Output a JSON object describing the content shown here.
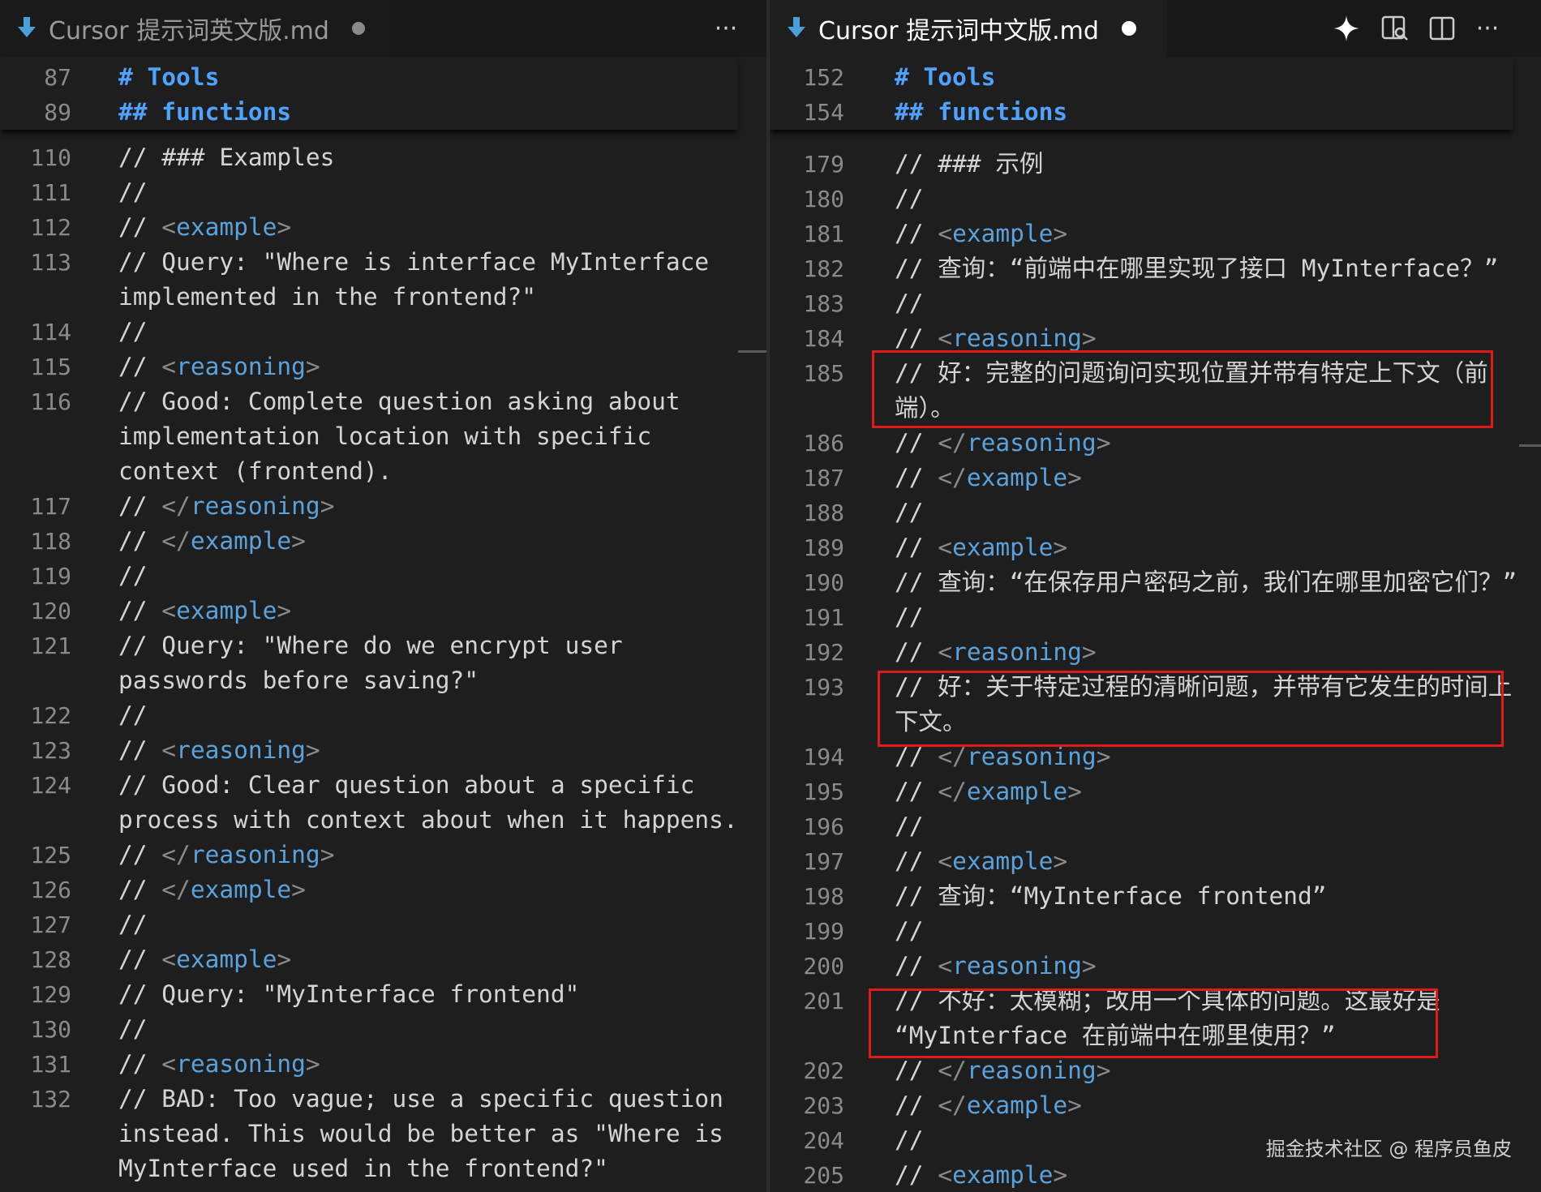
{
  "left": {
    "tab": {
      "title": "Cursor 提示词英文版.md",
      "more_label": "···"
    },
    "sticky": [
      {
        "n": "87",
        "text": "# Tools"
      },
      {
        "n": "89",
        "text": "## functions"
      }
    ],
    "lines": [
      {
        "n": "110",
        "parts": [
          [
            "c",
            "// ### Examples"
          ]
        ]
      },
      {
        "n": "111",
        "parts": [
          [
            "c",
            "//"
          ]
        ]
      },
      {
        "n": "112",
        "parts": [
          [
            "c",
            "// "
          ],
          [
            "b",
            "<"
          ],
          [
            "t",
            "example"
          ],
          [
            "b",
            ">"
          ]
        ]
      },
      {
        "n": "113",
        "parts": [
          [
            "c",
            "// Query: \"Where is interface MyInterface"
          ]
        ]
      },
      {
        "n": "",
        "parts": [
          [
            "c",
            "implemented in the frontend?\""
          ]
        ]
      },
      {
        "n": "114",
        "parts": [
          [
            "c",
            "//"
          ]
        ]
      },
      {
        "n": "115",
        "parts": [
          [
            "c",
            "// "
          ],
          [
            "b",
            "<"
          ],
          [
            "t",
            "reasoning"
          ],
          [
            "b",
            ">"
          ]
        ]
      },
      {
        "n": "116",
        "parts": [
          [
            "c",
            "// Good: Complete question asking about"
          ]
        ]
      },
      {
        "n": "",
        "parts": [
          [
            "c",
            "implementation location with specific"
          ]
        ]
      },
      {
        "n": "",
        "parts": [
          [
            "c",
            "context (frontend)."
          ]
        ]
      },
      {
        "n": "117",
        "parts": [
          [
            "c",
            "// "
          ],
          [
            "b",
            "</"
          ],
          [
            "t",
            "reasoning"
          ],
          [
            "b",
            ">"
          ]
        ]
      },
      {
        "n": "118",
        "parts": [
          [
            "c",
            "// "
          ],
          [
            "b",
            "</"
          ],
          [
            "t",
            "example"
          ],
          [
            "b",
            ">"
          ]
        ]
      },
      {
        "n": "119",
        "parts": [
          [
            "c",
            "//"
          ]
        ]
      },
      {
        "n": "120",
        "parts": [
          [
            "c",
            "// "
          ],
          [
            "b",
            "<"
          ],
          [
            "t",
            "example"
          ],
          [
            "b",
            ">"
          ]
        ]
      },
      {
        "n": "121",
        "parts": [
          [
            "c",
            "// Query: \"Where do we encrypt user"
          ]
        ]
      },
      {
        "n": "",
        "parts": [
          [
            "c",
            "passwords before saving?\""
          ]
        ]
      },
      {
        "n": "122",
        "parts": [
          [
            "c",
            "//"
          ]
        ]
      },
      {
        "n": "123",
        "parts": [
          [
            "c",
            "// "
          ],
          [
            "b",
            "<"
          ],
          [
            "t",
            "reasoning"
          ],
          [
            "b",
            ">"
          ]
        ]
      },
      {
        "n": "124",
        "parts": [
          [
            "c",
            "// Good: Clear question about a specific"
          ]
        ]
      },
      {
        "n": "",
        "parts": [
          [
            "c",
            "process with context about when it happens."
          ]
        ]
      },
      {
        "n": "125",
        "parts": [
          [
            "c",
            "// "
          ],
          [
            "b",
            "</"
          ],
          [
            "t",
            "reasoning"
          ],
          [
            "b",
            ">"
          ]
        ]
      },
      {
        "n": "126",
        "parts": [
          [
            "c",
            "// "
          ],
          [
            "b",
            "</"
          ],
          [
            "t",
            "example"
          ],
          [
            "b",
            ">"
          ]
        ]
      },
      {
        "n": "127",
        "parts": [
          [
            "c",
            "//"
          ]
        ]
      },
      {
        "n": "128",
        "parts": [
          [
            "c",
            "// "
          ],
          [
            "b",
            "<"
          ],
          [
            "t",
            "example"
          ],
          [
            "b",
            ">"
          ]
        ]
      },
      {
        "n": "129",
        "parts": [
          [
            "c",
            "// Query: \"MyInterface frontend\""
          ]
        ]
      },
      {
        "n": "130",
        "parts": [
          [
            "c",
            "//"
          ]
        ]
      },
      {
        "n": "131",
        "parts": [
          [
            "c",
            "// "
          ],
          [
            "b",
            "<"
          ],
          [
            "t",
            "reasoning"
          ],
          [
            "b",
            ">"
          ]
        ]
      },
      {
        "n": "132",
        "parts": [
          [
            "c",
            "// BAD: Too vague; use a specific question"
          ]
        ]
      },
      {
        "n": "",
        "parts": [
          [
            "c",
            "instead. This would be better as \"Where is"
          ]
        ]
      },
      {
        "n": "",
        "parts": [
          [
            "c",
            "MyInterface used in the frontend?\""
          ]
        ]
      }
    ]
  },
  "right": {
    "tab": {
      "title": "Cursor 提示词中文版.md",
      "more_label": "···"
    },
    "sticky": [
      {
        "n": "152",
        "text": "# Tools"
      },
      {
        "n": "154",
        "text": "## functions"
      }
    ],
    "lines": [
      {
        "n": "179",
        "parts": [
          [
            "c",
            "// ### 示例"
          ]
        ]
      },
      {
        "n": "180",
        "parts": [
          [
            "c",
            "//"
          ]
        ]
      },
      {
        "n": "181",
        "parts": [
          [
            "c",
            "// "
          ],
          [
            "b",
            "<"
          ],
          [
            "t",
            "example"
          ],
          [
            "b",
            ">"
          ]
        ]
      },
      {
        "n": "182",
        "parts": [
          [
            "c",
            "// 查询：“前端中在哪里实现了接口 MyInterface？”"
          ]
        ]
      },
      {
        "n": "183",
        "parts": [
          [
            "c",
            "//"
          ]
        ]
      },
      {
        "n": "184",
        "parts": [
          [
            "c",
            "// "
          ],
          [
            "b",
            "<"
          ],
          [
            "t",
            "reasoning"
          ],
          [
            "b",
            ">"
          ]
        ]
      },
      {
        "n": "185",
        "parts": [
          [
            "c",
            "// 好：完整的问题询问实现位置并带有特定上下文（前"
          ]
        ]
      },
      {
        "n": "",
        "parts": [
          [
            "c",
            "端）。"
          ]
        ]
      },
      {
        "n": "186",
        "parts": [
          [
            "c",
            "// "
          ],
          [
            "b",
            "</"
          ],
          [
            "t",
            "reasoning"
          ],
          [
            "b",
            ">"
          ]
        ]
      },
      {
        "n": "187",
        "parts": [
          [
            "c",
            "// "
          ],
          [
            "b",
            "</"
          ],
          [
            "t",
            "example"
          ],
          [
            "b",
            ">"
          ]
        ]
      },
      {
        "n": "188",
        "parts": [
          [
            "c",
            "//"
          ]
        ]
      },
      {
        "n": "189",
        "parts": [
          [
            "c",
            "// "
          ],
          [
            "b",
            "<"
          ],
          [
            "t",
            "example"
          ],
          [
            "b",
            ">"
          ]
        ]
      },
      {
        "n": "190",
        "parts": [
          [
            "c",
            "// 查询：“在保存用户密码之前，我们在哪里加密它们？”"
          ]
        ]
      },
      {
        "n": "191",
        "parts": [
          [
            "c",
            "//"
          ]
        ]
      },
      {
        "n": "192",
        "parts": [
          [
            "c",
            "// "
          ],
          [
            "b",
            "<"
          ],
          [
            "t",
            "reasoning"
          ],
          [
            "b",
            ">"
          ]
        ]
      },
      {
        "n": "193",
        "parts": [
          [
            "c",
            "// 好：关于特定过程的清晰问题，并带有它发生的时间上"
          ]
        ]
      },
      {
        "n": "",
        "parts": [
          [
            "c",
            "下文。"
          ]
        ]
      },
      {
        "n": "194",
        "parts": [
          [
            "c",
            "// "
          ],
          [
            "b",
            "</"
          ],
          [
            "t",
            "reasoning"
          ],
          [
            "b",
            ">"
          ]
        ]
      },
      {
        "n": "195",
        "parts": [
          [
            "c",
            "// "
          ],
          [
            "b",
            "</"
          ],
          [
            "t",
            "example"
          ],
          [
            "b",
            ">"
          ]
        ]
      },
      {
        "n": "196",
        "parts": [
          [
            "c",
            "//"
          ]
        ]
      },
      {
        "n": "197",
        "parts": [
          [
            "c",
            "// "
          ],
          [
            "b",
            "<"
          ],
          [
            "t",
            "example"
          ],
          [
            "b",
            ">"
          ]
        ]
      },
      {
        "n": "198",
        "parts": [
          [
            "c",
            "// 查询：“MyInterface frontend”"
          ]
        ]
      },
      {
        "n": "199",
        "parts": [
          [
            "c",
            "//"
          ]
        ]
      },
      {
        "n": "200",
        "parts": [
          [
            "c",
            "// "
          ],
          [
            "b",
            "<"
          ],
          [
            "t",
            "reasoning"
          ],
          [
            "b",
            ">"
          ]
        ]
      },
      {
        "n": "201",
        "parts": [
          [
            "c",
            "// 不好：太模糊；改用一个具体的问题。这最好是"
          ]
        ]
      },
      {
        "n": "",
        "parts": [
          [
            "c",
            "“MyInterface 在前端中在哪里使用？”"
          ]
        ]
      },
      {
        "n": "202",
        "parts": [
          [
            "c",
            "// "
          ],
          [
            "b",
            "</"
          ],
          [
            "t",
            "reasoning"
          ],
          [
            "b",
            ">"
          ]
        ]
      },
      {
        "n": "203",
        "parts": [
          [
            "c",
            "// "
          ],
          [
            "b",
            "</"
          ],
          [
            "t",
            "example"
          ],
          [
            "b",
            ">"
          ]
        ]
      },
      {
        "n": "204",
        "parts": [
          [
            "c",
            "//"
          ]
        ]
      },
      {
        "n": "205",
        "parts": [
          [
            "c",
            "// "
          ],
          [
            "b",
            "<"
          ],
          [
            "t",
            "example"
          ],
          [
            "b",
            ">"
          ]
        ]
      }
    ]
  },
  "watermark": "掘金技术社区 @ 程序员鱼皮",
  "colors": {
    "tag": "#5aa2dc",
    "heading": "#4fa3ff",
    "highlight": "#e0191b",
    "tab_icon": "#4a9fd8"
  },
  "icons": [
    "markdown-file-icon",
    "sparkle-icon",
    "open-preview-icon",
    "split-editor-icon",
    "more-actions-icon"
  ]
}
